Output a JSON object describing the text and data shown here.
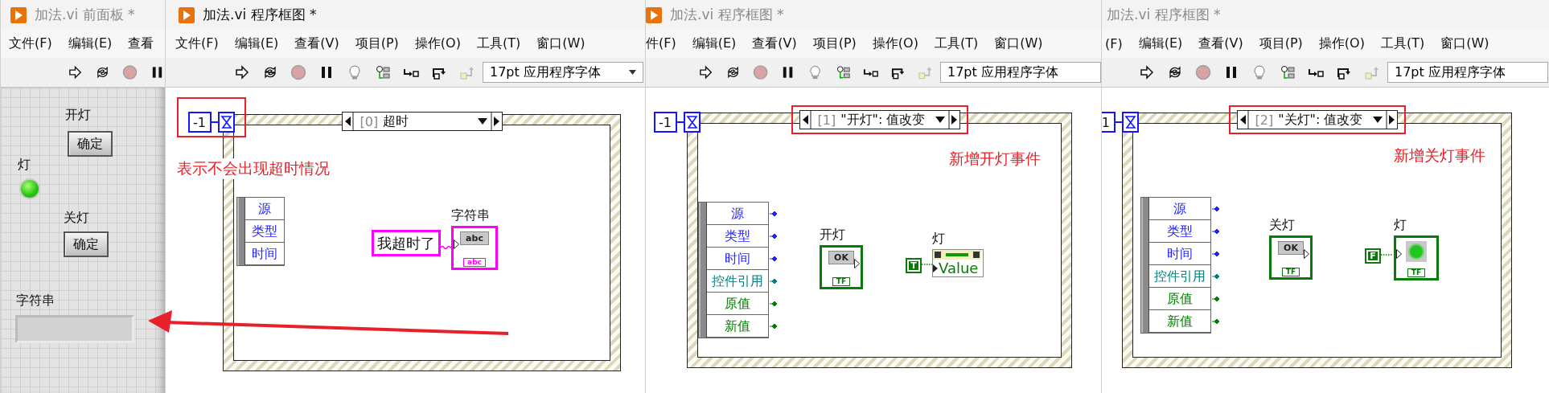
{
  "front_panel": {
    "title": "加法.vi 前面板 *",
    "active": false,
    "icon": true,
    "menus": [
      "文件(F)",
      "编辑(E)",
      "查看"
    ],
    "controls": [
      {
        "kind": "button",
        "label": "开灯",
        "text": "确定"
      },
      {
        "kind": "led",
        "label": "灯",
        "on": true
      },
      {
        "kind": "button",
        "label": "关灯",
        "text": "确定"
      },
      {
        "kind": "string",
        "label": "字符串"
      }
    ]
  },
  "diagrams": [
    {
      "title": "加法.vi 程序框图 *",
      "active": true,
      "icon": true,
      "menus": [
        "文件(F)",
        "编辑(E)",
        "查看(V)",
        "项目(P)",
        "操作(O)",
        "工具(T)",
        "窗口(W)"
      ],
      "font": "17pt 应用程序字体",
      "timeout": {
        "text": "-1",
        "highlighted": true
      },
      "case": {
        "index": "[0]",
        "name": "超时",
        "highlighted": false
      },
      "note": "表示不会出现超时情况",
      "terminals": false,
      "event_data": [
        {
          "text": "源",
          "color": "#1f1fff"
        },
        {
          "text": "类型",
          "color": "#1f1fff"
        },
        {
          "text": "时间",
          "color": "#1f1fff"
        }
      ],
      "nodes": [
        {
          "kind": "string_constant",
          "text": "我超时了"
        },
        {
          "kind": "string_indicator",
          "label": "字符串",
          "glyph": "abc",
          "tag": "abc"
        }
      ]
    },
    {
      "title": "加法.vi 程序框图 *",
      "active": false,
      "icon": true,
      "menus": [
        "件(F)",
        "编辑(E)",
        "查看(V)",
        "项目(P)",
        "操作(O)",
        "工具(T)",
        "窗口(W)"
      ],
      "font": "17pt 应用程序字体",
      "timeout": {
        "text": "-1",
        "highlighted": false
      },
      "case": {
        "index": "[1]",
        "name": "\"开灯\": 值改变",
        "highlighted": true
      },
      "note": "新增开灯事件",
      "terminals": true,
      "event_data": [
        {
          "text": "源",
          "color": "#1f1fff"
        },
        {
          "text": "类型",
          "color": "#1f1fff"
        },
        {
          "text": "时间",
          "color": "#1f1fff"
        },
        {
          "text": "控件引用",
          "color": "#008080"
        },
        {
          "text": "原值",
          "color": "#008000"
        },
        {
          "text": "新值",
          "color": "#008000"
        }
      ],
      "nodes": [
        {
          "kind": "bool_control",
          "label": "开灯",
          "glyph": "OK",
          "tag": "TF"
        },
        {
          "kind": "bool_constant",
          "text": "T"
        },
        {
          "kind": "property_node",
          "label": "灯",
          "property": "Value"
        }
      ]
    },
    {
      "title": "加法.vi 程序框图 *",
      "active": false,
      "icon": false,
      "menus": [
        "(F)",
        "编辑(E)",
        "查看(V)",
        "项目(P)",
        "操作(O)",
        "工具(T)",
        "窗口(W)"
      ],
      "font": "17pt 应用程序字体",
      "timeout": {
        "text": "1",
        "highlighted": false
      },
      "case": {
        "index": "[2]",
        "name": "\"关灯\": 值改变",
        "highlighted": true
      },
      "note": "新增关灯事件",
      "terminals": true,
      "event_data": [
        {
          "text": "源",
          "color": "#1f1fff"
        },
        {
          "text": "类型",
          "color": "#1f1fff"
        },
        {
          "text": "时间",
          "color": "#1f1fff"
        },
        {
          "text": "控件引用",
          "color": "#008080"
        },
        {
          "text": "原值",
          "color": "#008000"
        },
        {
          "text": "新值",
          "color": "#008000"
        }
      ],
      "nodes": [
        {
          "kind": "bool_control",
          "label": "关灯",
          "glyph": "OK",
          "tag": "TF"
        },
        {
          "kind": "bool_constant",
          "text": "F"
        },
        {
          "kind": "led_indicator",
          "label": "灯",
          "tag": "TF"
        }
      ]
    }
  ]
}
